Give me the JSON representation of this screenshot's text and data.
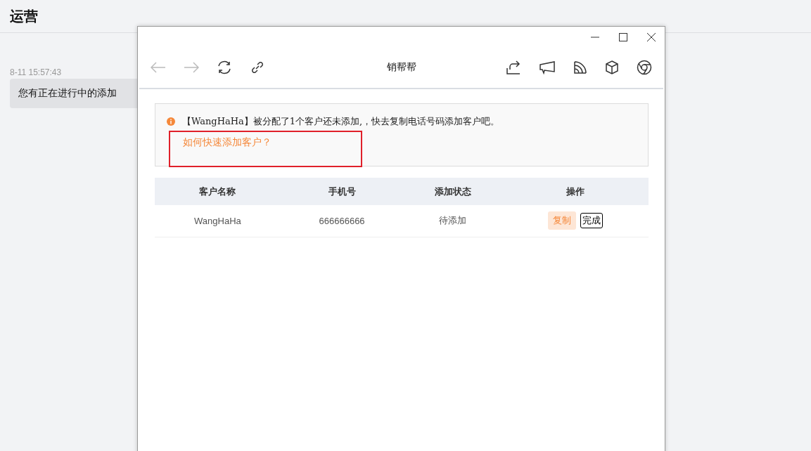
{
  "page": {
    "title": "运营",
    "message": {
      "time": "8-11 15:57:43",
      "text": "您有正在进行中的添加"
    }
  },
  "window": {
    "title": "销帮帮",
    "notice": {
      "text": "【WangHaHa】被分配了1个客户还未添加,，快去复制电话号码添加客户吧。",
      "link": "如何快速添加客户？",
      "highlighted": true
    },
    "table": {
      "columns": [
        "客户名称",
        "手机号",
        "添加状态",
        "操作"
      ],
      "rows": [
        {
          "name": "WangHaHa",
          "phone": "666666666",
          "status": "待添加",
          "actions": [
            {
              "label": "复制",
              "kind": "primary"
            },
            {
              "label": "完成",
              "kind": "outline"
            }
          ]
        }
      ]
    }
  }
}
